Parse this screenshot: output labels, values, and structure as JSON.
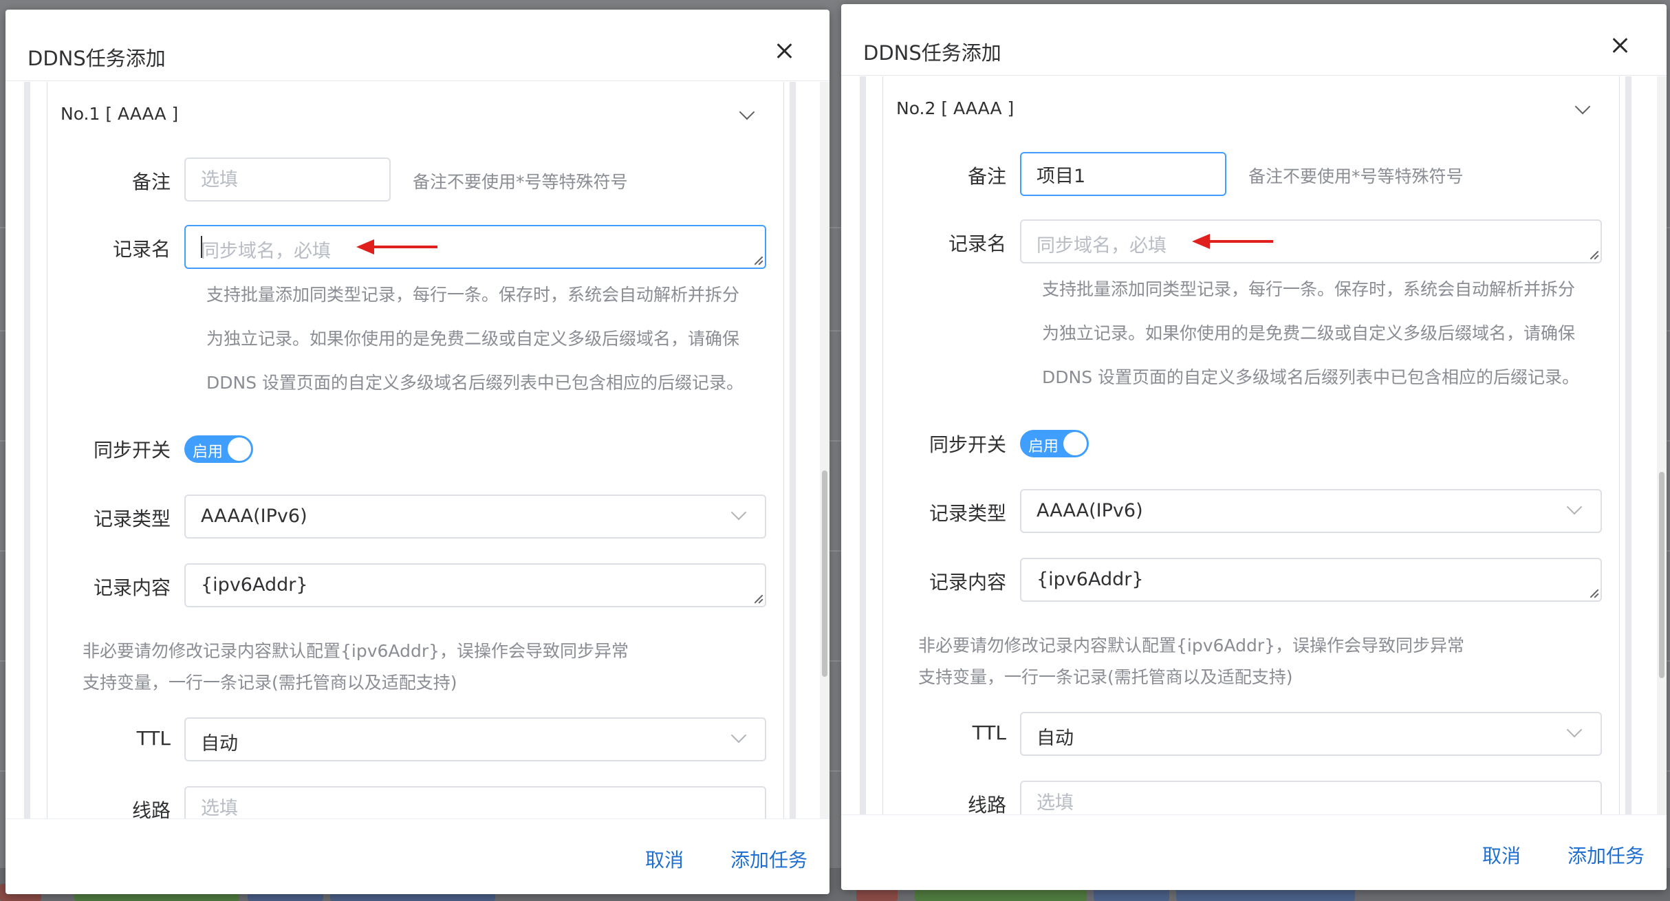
{
  "dialogs": [
    {
      "title": "DDNS任务添加",
      "section_title": "No.1 [ AAAA ]",
      "fields": {
        "remark": {
          "label": "备注",
          "value": "",
          "placeholder": "选填",
          "hint": "备注不要使用*号等特殊符号"
        },
        "record_name": {
          "label": "记录名",
          "value": "",
          "placeholder": "同步域名，必填",
          "help": [
            "支持批量添加同类型记录，每行一条。保存时，系统会自动解析并拆分",
            "为独立记录。如果你使用的是免费二级或自定义多级后缀域名，请确保",
            "DDNS 设置页面的自定义多级域名后缀列表中已包含相应的后缀记录。"
          ]
        },
        "sync_switch": {
          "label": "同步开关",
          "state_label": "启用",
          "on": true
        },
        "record_type": {
          "label": "记录类型",
          "value": "AAAA(IPv6)"
        },
        "record_content": {
          "label": "记录内容",
          "value": "{ipv6Addr}",
          "help": [
            "非必要请勿修改记录内容默认配置{ipv6Addr}，误操作会导致同步异常",
            "支持变量，一行一条记录(需托管商以及适配支持)"
          ]
        },
        "ttl": {
          "label": "TTL",
          "value": "自动"
        },
        "line": {
          "label": "线路",
          "value": "",
          "placeholder": "选填"
        }
      },
      "footer": {
        "cancel_label": "取消",
        "submit_label": "添加任务"
      }
    },
    {
      "title": "DDNS任务添加",
      "section_title": "No.2 [ AAAA ]",
      "fields": {
        "remark": {
          "label": "备注",
          "value": "项目1",
          "placeholder": "选填",
          "hint": "备注不要使用*号等特殊符号"
        },
        "record_name": {
          "label": "记录名",
          "value": "",
          "placeholder": "同步域名，必填",
          "help": [
            "支持批量添加同类型记录，每行一条。保存时，系统会自动解析并拆分",
            "为独立记录。如果你使用的是免费二级或自定义多级后缀域名，请确保",
            "DDNS 设置页面的自定义多级域名后缀列表中已包含相应的后缀记录。"
          ]
        },
        "sync_switch": {
          "label": "同步开关",
          "state_label": "启用",
          "on": true
        },
        "record_type": {
          "label": "记录类型",
          "value": "AAAA(IPv6)"
        },
        "record_content": {
          "label": "记录内容",
          "value": "{ipv6Addr}",
          "help": [
            "非必要请勿修改记录内容默认配置{ipv6Addr}，误操作会导致同步异常",
            "支持变量，一行一条记录(需托管商以及适配支持)"
          ]
        },
        "ttl": {
          "label": "TTL",
          "value": "自动"
        },
        "line": {
          "label": "线路",
          "value": "",
          "placeholder": "选填"
        }
      },
      "footer": {
        "cancel_label": "取消",
        "submit_label": "添加任务"
      }
    }
  ],
  "colors": {
    "accent": "#409eff",
    "link": "#1f6fd0",
    "annotation_arrow": "#e0201c",
    "muted_text": "#8a8d93"
  },
  "icons": {
    "close": "close-icon",
    "collapse": "chevron-down-icon",
    "select": "chevron-down-icon"
  }
}
